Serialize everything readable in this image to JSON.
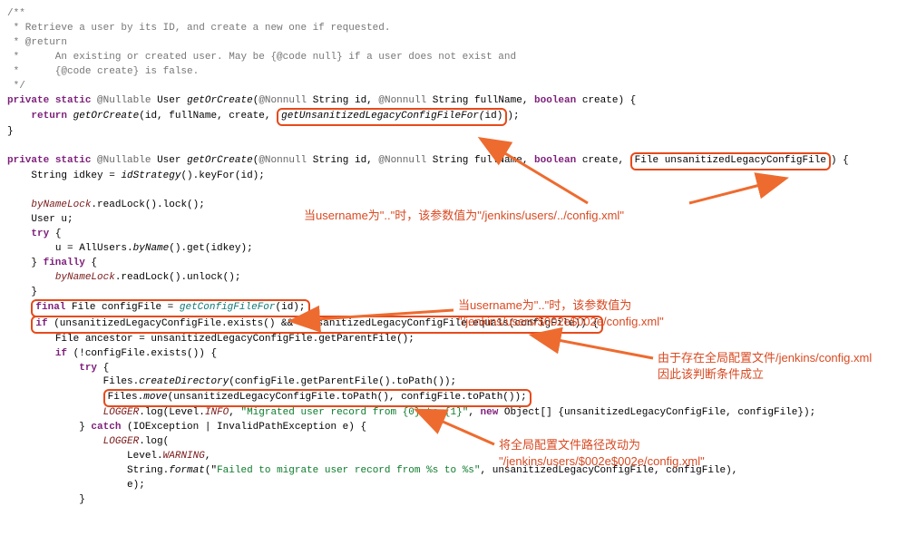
{
  "comment": {
    "open": "/**",
    "l1": " * Retrieve a user by its ID, and create a new one if requested.",
    "l2": " * @return",
    "l3": " *      An existing or created user. May be {@code null} if a user does not exist and",
    "l4": " *      {@code create} is false.",
    "close": " */"
  },
  "sig1": {
    "kw_private": "private",
    "kw_static": "static",
    "ann_nullable": "@Nullable",
    "retType": "User",
    "name": "getOrCreate",
    "ann_nonnull": "@Nonnull",
    "pString": "String",
    "p_id": "id",
    "p_fullName": "fullName",
    "pBoolean": "boolean",
    "p_create": "create",
    "kw_return": "return",
    "call": "getOrCreate",
    "args": "(id, fullName, create,",
    "hl_call": "getUnsanitizedLegacyConfigFileFor(",
    "hl_arg": "id",
    "hl_close": ")",
    "tail": ");"
  },
  "sig2": {
    "kw_private": "private",
    "kw_static": "static",
    "ann_nullable": "@Nullable",
    "retType": "User",
    "name": "getOrCreate",
    "ann_nonnull": "@Nonnull",
    "pString": "String",
    "p_id": "id",
    "p_fullName": "fullName",
    "pBoolean": "boolean",
    "p_create": "create",
    "hl_paramType": "File",
    "hl_paramName": "unsanitizedLegacyConfigFile",
    "l2": "String idkey = ",
    "l2call": "idStrategy",
    "l2rest": "().keyFor(id);",
    "l3a": "byNameLock",
    "l3b": ".readLock().lock();",
    "l4": "User u;",
    "kw_try": "try",
    "l5a": "u = AllUsers.",
    "l5call": "byName",
    "l5b": "().get(idkey);",
    "kw_finally": "finally",
    "l6a": "byNameLock",
    "l6b": ".readLock().unlock();",
    "hl_cfg_kwfinal": "final",
    "hl_cfg_type": "File",
    "hl_cfg_var": "configFile = ",
    "hl_cfg_call": "getConfigFileFor",
    "hl_cfg_args": "(id);",
    "if_kw": "if",
    "if_text1": " (unsanitizedLegacyConfigFile.exists() && !unsanitizedLegacyConfigFile.equals(configFile)) {",
    "l_anc": "File ancestor = unsanitizedLegacyConfigFile.getParentFile();",
    "if2": "if (!configFile.exists()) {",
    "kw_try2": "try",
    "l_createDir": "Files.",
    "l_createDir_call": "createDirectory",
    "l_createDir_rest": "(configFile.getParentFile().toPath());",
    "hl_move": "Files.",
    "hl_move_call": "move",
    "hl_move_rest": "(unsanitizedLegacyConfigFile.toPath(), configFile.toPath());",
    "l_logger": "LOGGER",
    "l_log1": ".log(Level.",
    "l_info": "INFO",
    "l_logmsg": ", ",
    "l_logstr": "\"Migrated user record from {0} to {1}\"",
    "l_logtail": ", ",
    "kw_new": "new",
    "l_logtail2": " Object[] {unsanitizedLegacyConfigFile, configFile});",
    "kw_catch": "catch",
    "catch_sig": " (IOException | InvalidPathException e) {",
    "l_log2a": "LOGGER",
    "l_log2b": ".log(",
    "l_level": "Level.",
    "l_warning": "WARNING",
    "l_comma": ",",
    "l_fmt": "String.",
    "l_fmt_call": "format",
    "l_fmt_str": "(\"",
    "l_fmt_str2": "Failed to migrate user record from %s to %s\"",
    "l_fmt_tail": ", unsanitizedLegacyConfigFile, configFile),",
    "l_e": "e);"
  },
  "annotations": {
    "a1": "当username为\"..\"时，该参数值为\"/jenkins/users/../config.xml\"",
    "a2a": "当username为\"..\"时，该参数值为",
    "a2b": "\"/jenkins/users/$002e$002e/config.xml\"",
    "a3a": "由于存在全局配置文件/jenkins/config.xml",
    "a3b": "因此该判断条件成立",
    "a4a": "将全局配置文件路径改动为",
    "a4b": "\"/jenkins/users/$002e$002e/config.xml\""
  }
}
